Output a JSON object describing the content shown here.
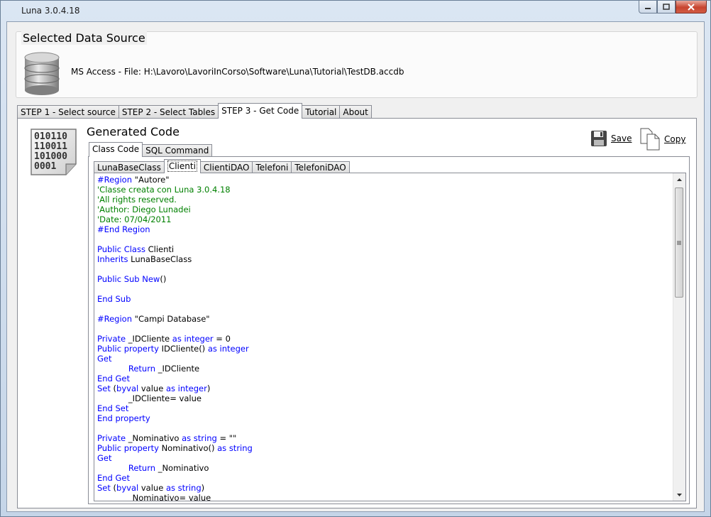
{
  "window": {
    "title": "Luna 3.0.4.18"
  },
  "data_source": {
    "group_title": "Selected Data Source",
    "text": "MS Access - File: H:\\Lavoro\\LavoriInCorso\\Software\\Luna\\Tutorial\\TestDB.accdb"
  },
  "main_tabs": [
    {
      "label": "STEP 1 - Select source",
      "active": false
    },
    {
      "label": "STEP 2 - Select Tables",
      "active": false
    },
    {
      "label": "STEP 3 - Get Code",
      "active": true
    },
    {
      "label": "Tutorial",
      "active": false
    },
    {
      "label": "About",
      "active": false
    }
  ],
  "generated": {
    "title": "Generated Code",
    "save_label": "Save",
    "copy_label": "Copy",
    "code_icon_text": [
      "010110",
      "110011",
      "101000",
      "0001"
    ]
  },
  "sub_tabs": [
    {
      "label": "Class Code",
      "active": true
    },
    {
      "label": "SQL Command",
      "active": false
    }
  ],
  "class_tabs": [
    {
      "label": "LunaBaseClass",
      "active": false
    },
    {
      "label": "Clienti",
      "active": true
    },
    {
      "label": "ClientiDAO",
      "active": false
    },
    {
      "label": "Telefoni",
      "active": false
    },
    {
      "label": "TelefoniDAO",
      "active": false
    }
  ],
  "colors": {
    "keyword": "#0000ff",
    "comment": "#008000",
    "text": "#000000"
  },
  "code_lines": [
    [
      [
        "kw",
        "#Region "
      ],
      [
        "t",
        "\"Autore\""
      ]
    ],
    [
      [
        "cm",
        "'Classe creata con Luna 3.0.4.18"
      ]
    ],
    [
      [
        "cm",
        "'All rights reserved."
      ]
    ],
    [
      [
        "cm",
        "'Author: Diego Lunadei"
      ]
    ],
    [
      [
        "cm",
        "'Date: 07/04/2011"
      ]
    ],
    [
      [
        "kw",
        "#End Region"
      ]
    ],
    [],
    [
      [
        "kw",
        "Public Class "
      ],
      [
        "t",
        "Clienti"
      ]
    ],
    [
      [
        "kw",
        "Inherits "
      ],
      [
        "t",
        "LunaBaseClass"
      ]
    ],
    [],
    [
      [
        "kw",
        "Public Sub New"
      ],
      [
        "t",
        "()"
      ]
    ],
    [],
    [
      [
        "kw",
        "End Sub"
      ]
    ],
    [],
    [
      [
        "kw",
        "#Region "
      ],
      [
        "t",
        "\"Campi Database\""
      ]
    ],
    [],
    [
      [
        "kw",
        "Private "
      ],
      [
        "t",
        "_IDCliente "
      ],
      [
        "kw",
        "as integer"
      ],
      [
        "t",
        " = 0"
      ]
    ],
    [
      [
        "kw",
        "Public property "
      ],
      [
        "t",
        "IDCliente() "
      ],
      [
        "kw",
        "as integer"
      ]
    ],
    [
      [
        "kw",
        "Get"
      ]
    ],
    [
      [
        "t",
        "            "
      ],
      [
        "kw",
        "Return "
      ],
      [
        "t",
        "_IDCliente"
      ]
    ],
    [
      [
        "kw",
        "End Get"
      ]
    ],
    [
      [
        "kw",
        "Set "
      ],
      [
        "t",
        "("
      ],
      [
        "kw",
        "byval "
      ],
      [
        "t",
        "value "
      ],
      [
        "kw",
        "as integer"
      ],
      [
        "t",
        ")"
      ]
    ],
    [
      [
        "t",
        "            _IDCliente= value"
      ]
    ],
    [
      [
        "kw",
        "End Set"
      ]
    ],
    [
      [
        "kw",
        "End property"
      ]
    ],
    [],
    [
      [
        "kw",
        "Private "
      ],
      [
        "t",
        "_Nominativo "
      ],
      [
        "kw",
        "as string"
      ],
      [
        "t",
        " = \"\""
      ]
    ],
    [
      [
        "kw",
        "Public property "
      ],
      [
        "t",
        "Nominativo() "
      ],
      [
        "kw",
        "as string"
      ]
    ],
    [
      [
        "kw",
        "Get"
      ]
    ],
    [
      [
        "t",
        "            "
      ],
      [
        "kw",
        "Return "
      ],
      [
        "t",
        "_Nominativo"
      ]
    ],
    [
      [
        "kw",
        "End Get"
      ]
    ],
    [
      [
        "kw",
        "Set "
      ],
      [
        "t",
        "("
      ],
      [
        "kw",
        "byval "
      ],
      [
        "t",
        "value "
      ],
      [
        "kw",
        "as string"
      ],
      [
        "t",
        ")"
      ]
    ],
    [
      [
        "t",
        "            _Nominativo= value"
      ]
    ]
  ]
}
